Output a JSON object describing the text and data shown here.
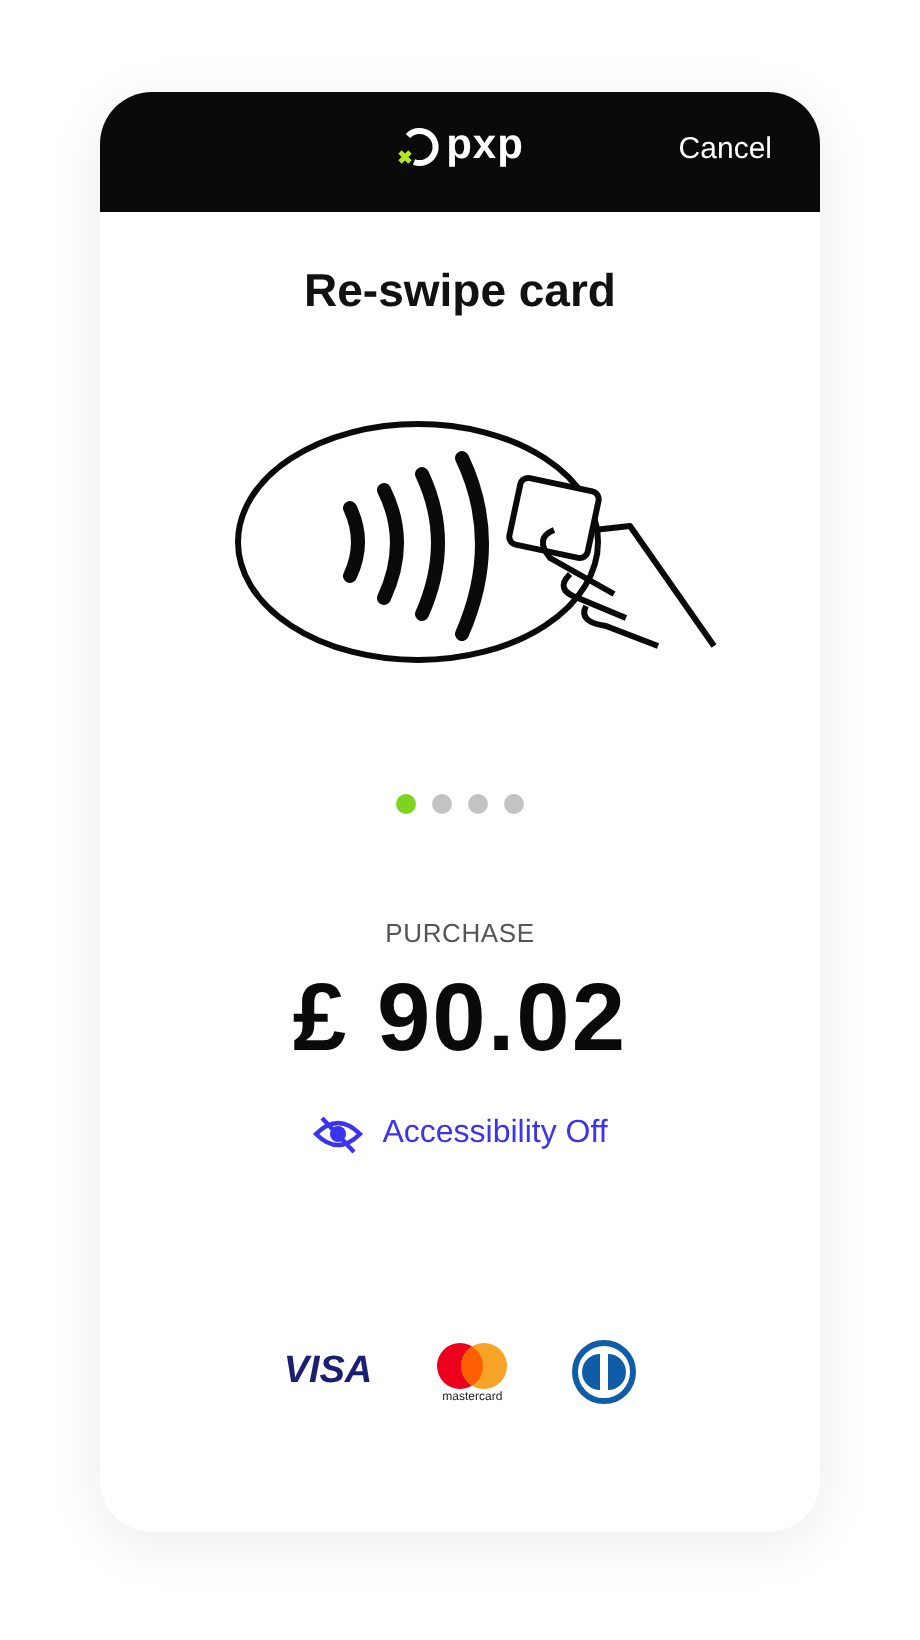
{
  "header": {
    "logo": "pxp",
    "cancel": "Cancel"
  },
  "title": "Re-swipe card",
  "steps": [
    {
      "selected": true
    },
    {
      "selected": false
    },
    {
      "selected": false
    },
    {
      "selected": false
    }
  ],
  "purchase": {
    "label": "PURCHASE",
    "amount": "£ 90.02"
  },
  "accessibility": {
    "label": "Accessibility Off",
    "on": false
  },
  "card_brands": [
    {
      "kind": "visa",
      "text": "VISA"
    },
    {
      "kind": "mastercard",
      "text": "mastercard"
    },
    {
      "kind": "diners"
    }
  ]
}
